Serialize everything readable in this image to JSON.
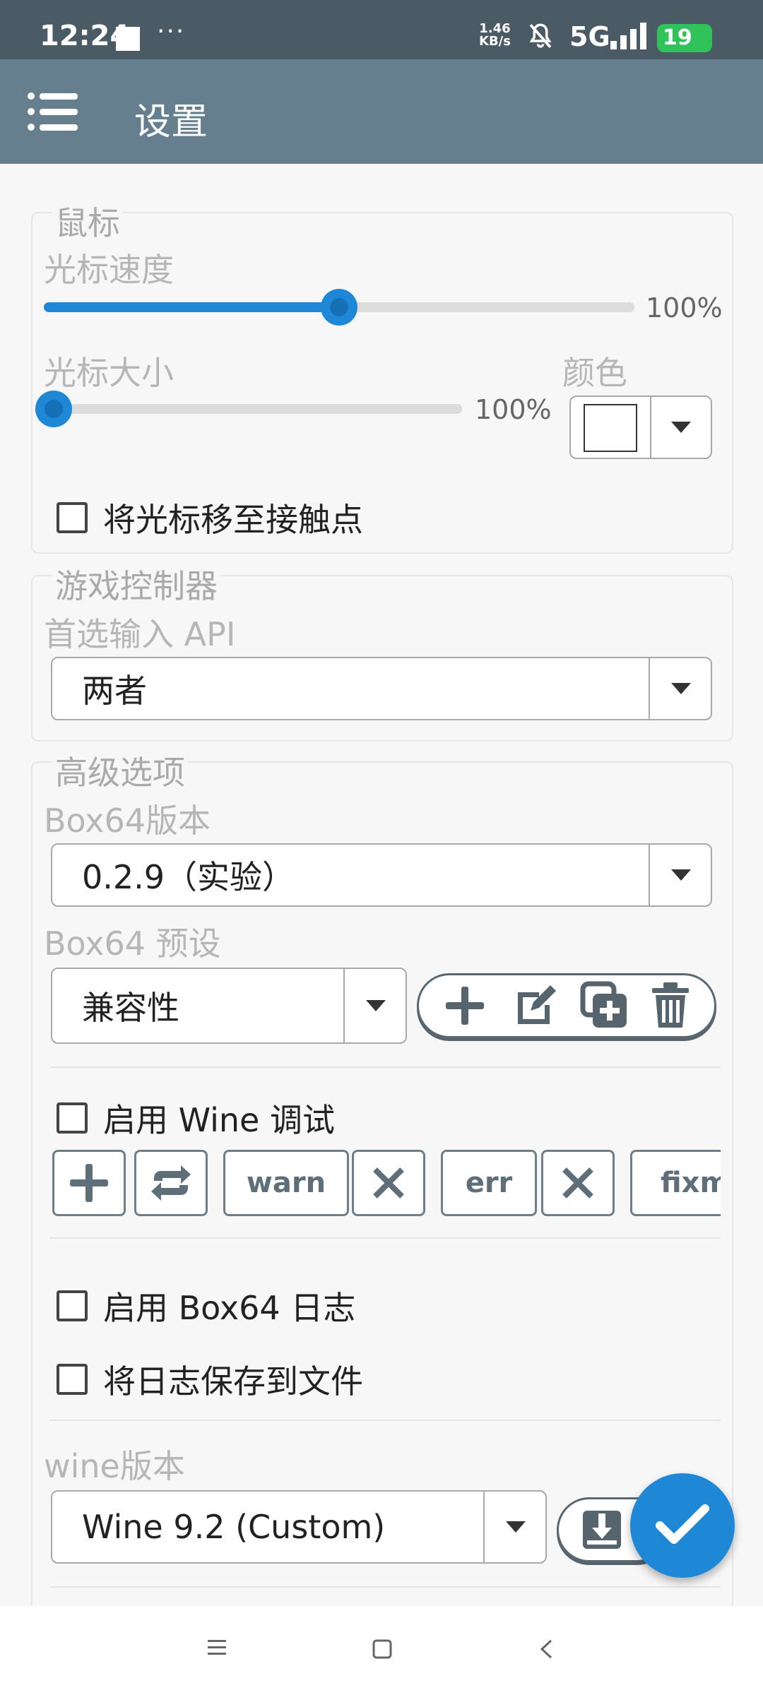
{
  "status_bar": {
    "time": "12:24",
    "more": "···",
    "speed_value": "1.46",
    "speed_unit": "KB/s",
    "network": "5G",
    "battery": "19"
  },
  "app_bar": {
    "title": "设置",
    "menu_icon": "menu-icon"
  },
  "mouse": {
    "legend": "鼠标",
    "cursor_speed": {
      "label": "光标速度",
      "percent_text": "100%",
      "level": 0.5
    },
    "cursor_size": {
      "label": "光标大小",
      "percent_text": "100%",
      "level": 0.0
    },
    "color": {
      "label": "颜色",
      "value": "#ffffff"
    },
    "move_cursor_checkbox": {
      "label": "将光标移至接触点",
      "checked": false
    }
  },
  "controller": {
    "legend": "游戏控制器",
    "api_label": "首选输入 API",
    "api_value": "两者"
  },
  "advanced": {
    "legend": "高级选项",
    "box64_version_label": "Box64版本",
    "box64_version_value": "0.2.9（实验）",
    "box64_preset_label": "Box64 预设",
    "box64_preset_value": "兼容性",
    "preset_actions": [
      "add-icon",
      "edit-icon",
      "duplicate-icon",
      "delete-icon"
    ],
    "wine_debug": {
      "label": "启用 Wine 调试",
      "checked": false
    },
    "debug_channels": [
      "warn",
      "err",
      "fixm"
    ],
    "box64_log": {
      "label": "启用 Box64 日志",
      "checked": false
    },
    "save_log": {
      "label": "将日志保存到文件",
      "checked": false
    },
    "wine_version_label": "wine版本",
    "wine_version_value": "Wine 9.2 (Custom)"
  },
  "fab_icon": "check-icon",
  "nav_bar": [
    "menu-nav-icon",
    "home-nav-icon",
    "back-nav-icon"
  ]
}
